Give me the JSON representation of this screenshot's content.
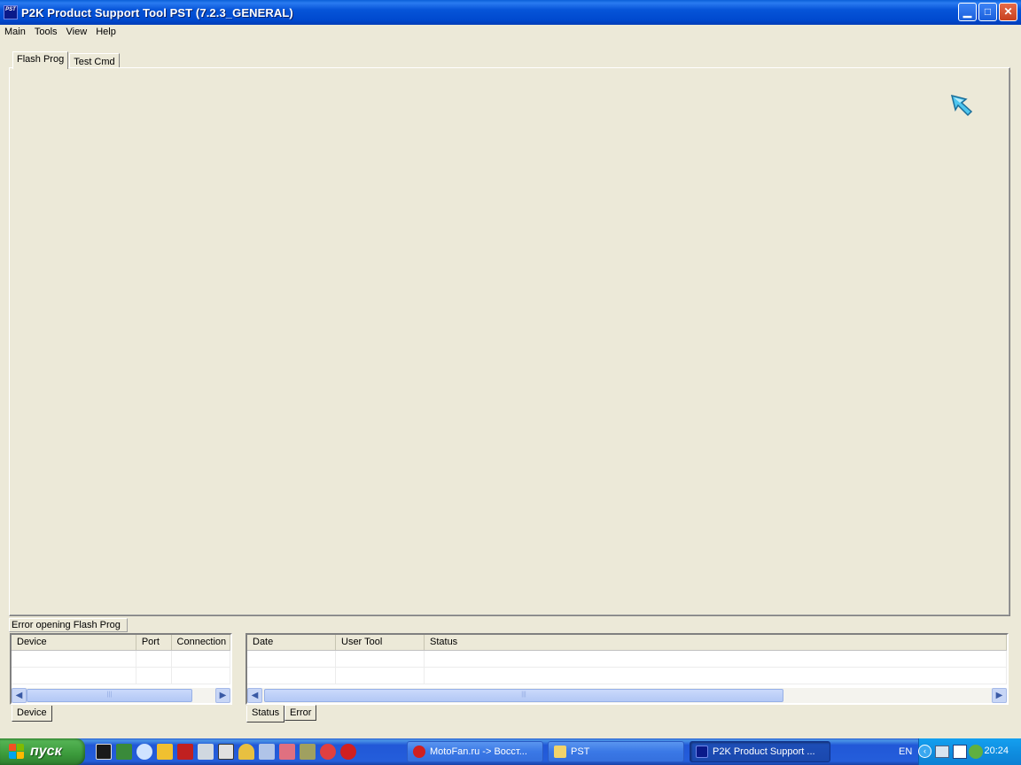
{
  "window": {
    "title": "P2K Product Support Tool PST (7.2.3_GENERAL)",
    "app_icon_text": "PST",
    "minimize_glyph": "▁",
    "maximize_glyph": "□",
    "close_glyph": "✕"
  },
  "menu": [
    "Main",
    "Tools",
    "View",
    "Help"
  ],
  "tabs": [
    {
      "label": "Flash Prog",
      "active": true
    },
    {
      "label": "Test Cmd",
      "active": false
    }
  ],
  "status_message": "Error opening Flash Prog",
  "device_list": {
    "columns": [
      "Device",
      "Port",
      "Connection"
    ],
    "rows": []
  },
  "log_list": {
    "columns": [
      "Date",
      "User Tool",
      "Status"
    ],
    "rows": []
  },
  "bottom_tabs_left": [
    "Device"
  ],
  "bottom_tabs_right": [
    "Status",
    "Error"
  ],
  "taskbar": {
    "start_label": "пуск",
    "tasks": [
      {
        "label": "MotoFan.ru -> Восст...",
        "icon": "opera-icon",
        "active": false
      },
      {
        "label": "PST",
        "icon": "folder-icon",
        "active": false
      },
      {
        "label": "P2K Product Support ...",
        "icon": "pst-app-icon",
        "active": true
      }
    ],
    "language": "EN",
    "clock": "20:24"
  },
  "colors": {
    "titlebar": "#0054e3",
    "window_bg": "#ece9d8",
    "taskbar": "#245edb",
    "start": "#3c9a3c",
    "tray": "#0f8ee0"
  }
}
